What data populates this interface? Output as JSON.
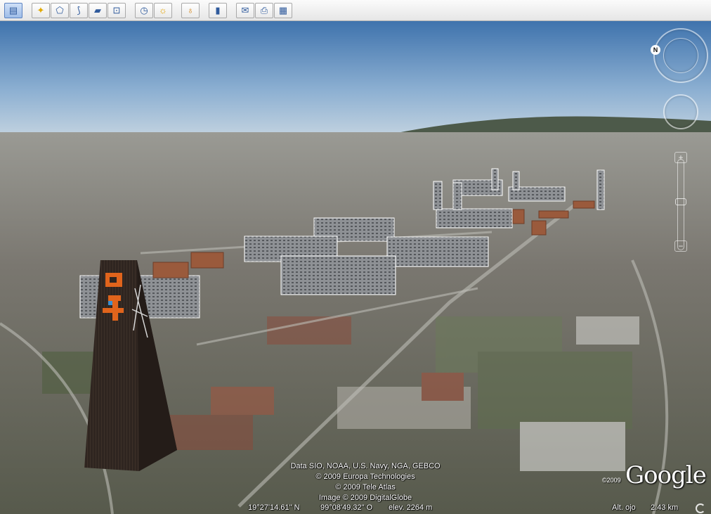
{
  "toolbar": {
    "buttons": [
      {
        "icon": "sidebar-toggle-icon",
        "glyph": "▤",
        "active": true
      },
      {
        "icon": "add-placemark-icon",
        "glyph": "✦"
      },
      {
        "icon": "add-polygon-icon",
        "glyph": "⬠"
      },
      {
        "icon": "add-path-icon",
        "glyph": "⟆"
      },
      {
        "icon": "add-image-overlay-icon",
        "glyph": "▰"
      },
      {
        "icon": "record-tour-icon",
        "glyph": "⊡"
      },
      {
        "icon": "historical-imagery-icon",
        "glyph": "◷"
      },
      {
        "icon": "sunlight-icon",
        "glyph": "☼"
      },
      {
        "icon": "switch-planet-icon",
        "glyph": "♁"
      },
      {
        "icon": "ruler-icon",
        "glyph": "▮"
      },
      {
        "icon": "email-icon",
        "glyph": "✉"
      },
      {
        "icon": "print-icon",
        "glyph": "⎙"
      },
      {
        "icon": "view-in-maps-icon",
        "glyph": "▦"
      }
    ]
  },
  "navigation": {
    "north_label": "N",
    "zoom_in": "+",
    "zoom_out": "−"
  },
  "credits": {
    "line1": "Data SIO, NOAA, U.S. Navy, NGA, GEBCO",
    "line2": "© 2009 Europa Technologies",
    "line3": "© 2009 Tele Atlas",
    "line4": "Image © 2009 DigitalGlobe"
  },
  "status": {
    "latitude": "19°27'14.61\" N",
    "longitude": "99°08'49.32\" O",
    "elevation": "elev. 2264 m",
    "eye_alt_label": "Alt. ojo",
    "eye_alt_value": "2.43 km"
  },
  "branding": {
    "logo_text": "Google",
    "year": "©2009"
  },
  "colors": {
    "sky_top": "#4f7fb6",
    "sky_horizon": "#b9cde0",
    "ground": "#6f6e68",
    "tower": "#2e2520",
    "tower_accent": "#e0641c"
  }
}
